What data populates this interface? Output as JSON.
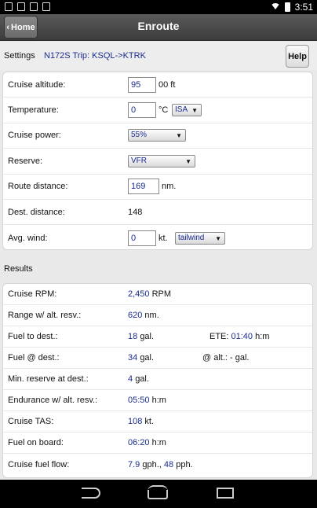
{
  "status_bar": {
    "time": "3:51"
  },
  "header": {
    "home_label": "Home",
    "title": "Enroute"
  },
  "settings": {
    "label": "Settings",
    "trip": "N172S Trip: KSQL->KTRK",
    "help_label": "Help"
  },
  "inputs": {
    "cruise_altitude": {
      "label": "Cruise altitude:",
      "value": "95",
      "unit": "00 ft"
    },
    "temperature": {
      "label": "Temperature:",
      "value": "0",
      "unit": "°C",
      "option": "ISA"
    },
    "cruise_power": {
      "label": "Cruise power:",
      "option": "55%"
    },
    "reserve": {
      "label": "Reserve:",
      "option": "VFR"
    },
    "route_distance": {
      "label": "Route distance:",
      "value": "169",
      "unit": "nm."
    },
    "dest_distance": {
      "label": "Dest. distance:",
      "value": "148"
    },
    "avg_wind": {
      "label": "Avg. wind:",
      "value": "0",
      "unit": "kt.",
      "option": "tailwind"
    }
  },
  "results_title": "Results",
  "results": {
    "cruise_rpm": {
      "label": "Cruise RPM:",
      "value": "2,450",
      "unit": "RPM"
    },
    "range": {
      "label": "Range w/ alt. resv.:",
      "value": "620",
      "unit": "nm."
    },
    "fuel_to_dest": {
      "label": "Fuel to dest.:",
      "value": "18",
      "unit": "gal.",
      "ete_label": "ETE:",
      "ete_value": "01:40",
      "ete_unit": "h:m"
    },
    "fuel_at_dest": {
      "label": "Fuel @ dest.:",
      "value": "34",
      "unit": "gal.",
      "alt_label": "@ alt.: - gal."
    },
    "min_reserve": {
      "label": "Min. reserve at dest.:",
      "value": "4",
      "unit": "gal."
    },
    "endurance": {
      "label": "Endurance w/ alt. resv.:",
      "value": "05:50",
      "unit": "h:m"
    },
    "cruise_tas": {
      "label": "Cruise TAS:",
      "value": "108",
      "unit": "kt."
    },
    "fuel_on_board": {
      "label": "Fuel on board:",
      "value": "06:20",
      "unit": "h:m"
    },
    "cruise_fuel_flow": {
      "label": "Cruise fuel flow:",
      "value": "7.9",
      "unit": "gph.,",
      "value2": "48",
      "unit2": "pph."
    }
  }
}
